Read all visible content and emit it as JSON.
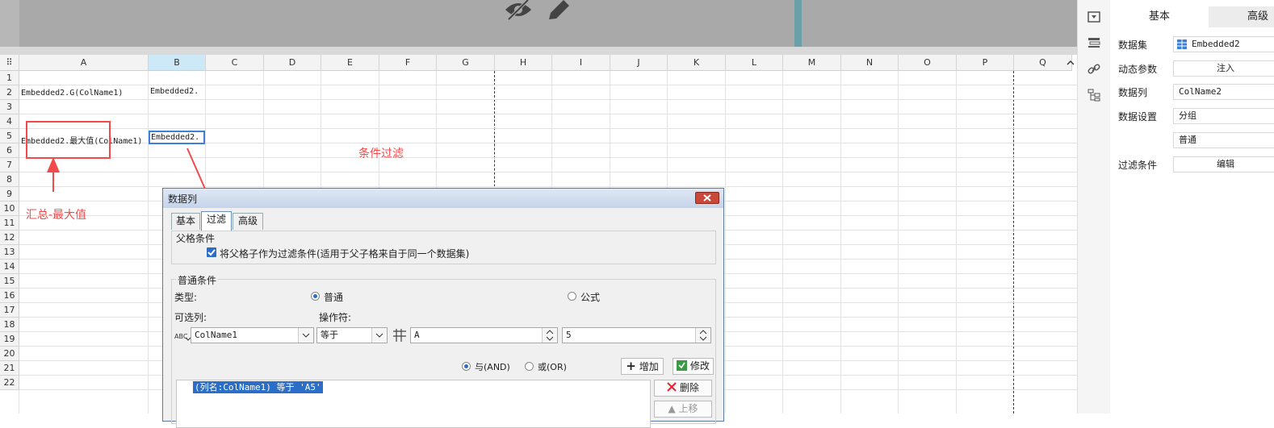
{
  "columns": [
    "A",
    "B",
    "C",
    "D",
    "E",
    "F",
    "G",
    "H",
    "I",
    "J",
    "K",
    "L",
    "M",
    "N",
    "O",
    "P",
    "Q"
  ],
  "rows": [
    "1",
    "2",
    "3",
    "4",
    "5",
    "6",
    "7",
    "8",
    "9",
    "10",
    "11",
    "12",
    "13",
    "14",
    "15",
    "16",
    "17",
    "18",
    "19",
    "20",
    "21",
    "22"
  ],
  "cells": {
    "a2": "Embedded2.G(ColName1)",
    "b2": "Embedded2.",
    "a5": "Embedded2.最大值(ColName1)",
    "b5": "Embedded2."
  },
  "annotations": {
    "summary_max": "汇总-最大值",
    "condition_filter": "条件过滤"
  },
  "colors": {
    "annotation_red": "#f24a4a",
    "accent_blue": "#2a6ec8"
  },
  "right_panel": {
    "tabs": [
      "基本",
      "高级"
    ],
    "rows": [
      {
        "label": "数据集",
        "value": "Embedded2"
      },
      {
        "label": "动态参数",
        "value": "注入"
      },
      {
        "label": "数据列",
        "value": "ColName2"
      },
      {
        "label": "数据设置",
        "value": "分组"
      },
      {
        "label": "",
        "value": "普通"
      },
      {
        "label": "过滤条件",
        "value": "编辑"
      }
    ]
  },
  "dialog": {
    "title": "数据列",
    "tabs": [
      "基本",
      "过滤",
      "高级"
    ],
    "parent_group_title": "父格条件",
    "parent_checkbox_label": "将父格子作为过滤条件(适用于父子格来自于同一个数据集)",
    "normal_group_title": "普通条件",
    "type_label": "类型:",
    "type_options": [
      "普通",
      "公式"
    ],
    "optional_col_label": "可选列:",
    "operator_label": "操作符:",
    "col_value": "ColName1",
    "operator_value": "等于",
    "value1": "A",
    "value2": "5",
    "logic_options": [
      "与(AND)",
      "或(OR)"
    ],
    "add_button": "增加",
    "modify_button": "修改",
    "delete_button": "删除",
    "move_up_button": "上移",
    "condition_item": "(列名:ColName1) 等于 'A5'"
  }
}
